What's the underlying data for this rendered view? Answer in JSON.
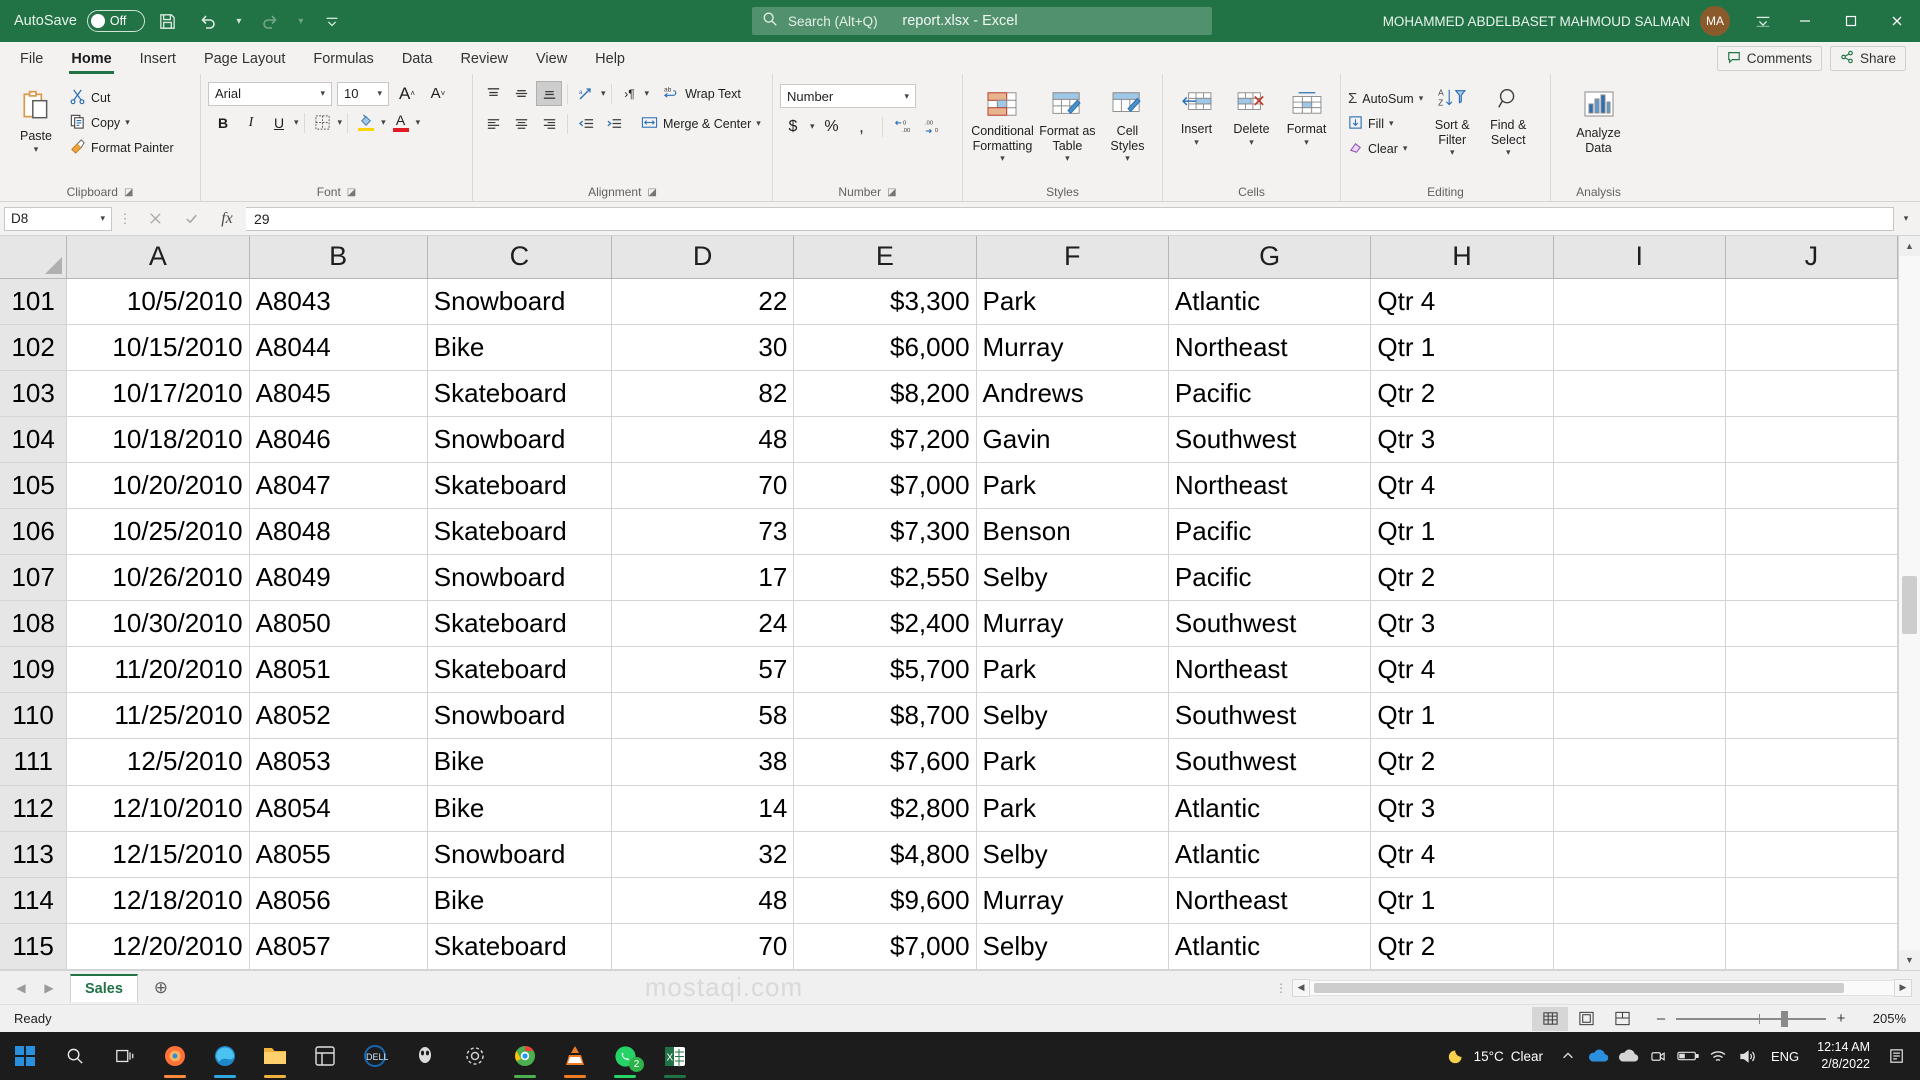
{
  "titlebar": {
    "autosave_label": "AutoSave",
    "autosave_state": "Off",
    "save_icon": "save-icon",
    "undo_icon": "undo-icon",
    "redo_icon": "redo-icon",
    "customize_qat_icon": "customize-quick-access-toolbar-icon",
    "document_title": "report.xlsx  -  Excel",
    "search_placeholder": "Search (Alt+Q)",
    "search_icon": "search-icon",
    "user_name": "MOHAMMED ABDELBASET MAHMOUD SALMAN",
    "avatar_initials": "MA",
    "ribbon_display_icon": "ribbon-display-options-icon",
    "minimize_label": "–",
    "maximize_label": "☐",
    "close_label": "✕"
  },
  "ribbon_tabs": [
    {
      "label": "File",
      "active": false
    },
    {
      "label": "Home",
      "active": true
    },
    {
      "label": "Insert",
      "active": false
    },
    {
      "label": "Page Layout",
      "active": false
    },
    {
      "label": "Formulas",
      "active": false
    },
    {
      "label": "Data",
      "active": false
    },
    {
      "label": "Review",
      "active": false
    },
    {
      "label": "View",
      "active": false
    },
    {
      "label": "Help",
      "active": false
    }
  ],
  "tabrow_right": {
    "comments_label": "Comments",
    "comments_icon": "comment-icon",
    "share_label": "Share",
    "share_icon": "share-icon"
  },
  "ribbon": {
    "clipboard": {
      "group_label": "Clipboard",
      "paste_label": "Paste",
      "cut_label": "Cut",
      "copy_label": "Copy",
      "format_painter_label": "Format Painter"
    },
    "font": {
      "group_label": "Font",
      "font_name": "Arial",
      "font_size": "10",
      "grow_font_label": "A",
      "shrink_font_label": "A",
      "bold_label": "B",
      "italic_label": "I",
      "underline_label": "U",
      "borders_icon": "borders-icon",
      "fill_color_icon": "fill-color-icon",
      "font_color_label": "A"
    },
    "alignment": {
      "group_label": "Alignment",
      "top_align_icon": "align-top-icon",
      "middle_align_icon": "align-middle-icon",
      "bottom_align_icon": "align-bottom-icon",
      "orientation_icon": "orientation-icon",
      "text_direction_icon": "text-direction-icon",
      "wrap_text_label": "Wrap Text",
      "align_left_icon": "align-left-icon",
      "align_center_icon": "align-center-icon",
      "align_right_icon": "align-right-icon",
      "decrease_indent_icon": "decrease-indent-icon",
      "increase_indent_icon": "increase-indent-icon",
      "merge_center_label": "Merge & Center"
    },
    "number": {
      "group_label": "Number",
      "format": "Number",
      "currency_label": "$",
      "percent_label": "%",
      "comma_label": ",",
      "increase_decimal_icon": "increase-decimal-icon",
      "decrease_decimal_icon": "decrease-decimal-icon"
    },
    "styles": {
      "group_label": "Styles",
      "conditional_formatting_label": "Conditional\nFormatting",
      "format_as_table_label": "Format as\nTable",
      "cell_styles_label": "Cell\nStyles"
    },
    "cells": {
      "group_label": "Cells",
      "insert_label": "Insert",
      "delete_label": "Delete",
      "format_label": "Format"
    },
    "editing": {
      "group_label": "Editing",
      "autosum_label": "AutoSum",
      "fill_label": "Fill",
      "clear_label": "Clear",
      "sort_filter_label": "Sort &\nFilter",
      "find_select_label": "Find &\nSelect"
    },
    "analysis": {
      "group_label": "Analysis",
      "analyze_data_label": "Analyze\nData"
    }
  },
  "formula_bar": {
    "name_box": "D8",
    "cancel_icon": "cancel-icon",
    "enter_icon": "confirm-icon",
    "function_icon": "insert-function-icon",
    "formula_value": "29"
  },
  "sheet": {
    "column_headers": [
      "A",
      "B",
      "C",
      "D",
      "E",
      "F",
      "G",
      "H",
      "I",
      "J"
    ],
    "rows": [
      {
        "row": "101",
        "cells": [
          "10/5/2010",
          "A8043",
          "Snowboard",
          "22",
          "$3,300",
          "Park",
          "Atlantic",
          "Qtr 4",
          "",
          ""
        ]
      },
      {
        "row": "102",
        "cells": [
          "10/15/2010",
          "A8044",
          "Bike",
          "30",
          "$6,000",
          "Murray",
          "Northeast",
          "Qtr 1",
          "",
          ""
        ]
      },
      {
        "row": "103",
        "cells": [
          "10/17/2010",
          "A8045",
          "Skateboard",
          "82",
          "$8,200",
          "Andrews",
          "Pacific",
          "Qtr 2",
          "",
          ""
        ]
      },
      {
        "row": "104",
        "cells": [
          "10/18/2010",
          "A8046",
          "Snowboard",
          "48",
          "$7,200",
          "Gavin",
          "Southwest",
          "Qtr 3",
          "",
          ""
        ]
      },
      {
        "row": "105",
        "cells": [
          "10/20/2010",
          "A8047",
          "Skateboard",
          "70",
          "$7,000",
          "Park",
          "Northeast",
          "Qtr 4",
          "",
          ""
        ]
      },
      {
        "row": "106",
        "cells": [
          "10/25/2010",
          "A8048",
          "Skateboard",
          "73",
          "$7,300",
          "Benson",
          "Pacific",
          "Qtr 1",
          "",
          ""
        ]
      },
      {
        "row": "107",
        "cells": [
          "10/26/2010",
          "A8049",
          "Snowboard",
          "17",
          "$2,550",
          "Selby",
          "Pacific",
          "Qtr 2",
          "",
          ""
        ]
      },
      {
        "row": "108",
        "cells": [
          "10/30/2010",
          "A8050",
          "Skateboard",
          "24",
          "$2,400",
          "Murray",
          "Southwest",
          "Qtr 3",
          "",
          ""
        ]
      },
      {
        "row": "109",
        "cells": [
          "11/20/2010",
          "A8051",
          "Skateboard",
          "57",
          "$5,700",
          "Park",
          "Northeast",
          "Qtr 4",
          "",
          ""
        ]
      },
      {
        "row": "110",
        "cells": [
          "11/25/2010",
          "A8052",
          "Snowboard",
          "58",
          "$8,700",
          "Selby",
          "Southwest",
          "Qtr 1",
          "",
          ""
        ]
      },
      {
        "row": "111",
        "cells": [
          "12/5/2010",
          "A8053",
          "Bike",
          "38",
          "$7,600",
          "Park",
          "Southwest",
          "Qtr 2",
          "",
          ""
        ]
      },
      {
        "row": "112",
        "cells": [
          "12/10/2010",
          "A8054",
          "Bike",
          "14",
          "$2,800",
          "Park",
          "Atlantic",
          "Qtr 3",
          "",
          ""
        ]
      },
      {
        "row": "113",
        "cells": [
          "12/15/2010",
          "A8055",
          "Snowboard",
          "32",
          "$4,800",
          "Selby",
          "Atlantic",
          "Qtr 4",
          "",
          ""
        ]
      },
      {
        "row": "114",
        "cells": [
          "12/18/2010",
          "A8056",
          "Bike",
          "48",
          "$9,600",
          "Murray",
          "Northeast",
          "Qtr 1",
          "",
          ""
        ]
      },
      {
        "row": "115",
        "cells": [
          "12/20/2010",
          "A8057",
          "Skateboard",
          "70",
          "$7,000",
          "Selby",
          "Atlantic",
          "Qtr 2",
          "",
          ""
        ]
      }
    ]
  },
  "sheet_tabs": {
    "prev_icon": "previous-sheet-icon",
    "next_icon": "next-sheet-icon",
    "tabs": [
      {
        "label": "Sales",
        "active": true
      }
    ],
    "add_sheet_label": "⊕",
    "watermark": "mostaqi.com"
  },
  "status_bar": {
    "status_text": "Ready",
    "normal_view_icon": "normal-view-icon",
    "page_layout_icon": "page-layout-view-icon",
    "page_break_icon": "page-break-preview-icon",
    "zoom_out_label": "–",
    "zoom_in_label": "+",
    "zoom_level": "205%"
  },
  "taskbar": {
    "start_icon": "windows-start-icon",
    "search_icon": "taskbar-search-icon",
    "task_view_icon": "task-view-icon",
    "apps": [
      {
        "name": "firefox-icon",
        "color": "#ff8a3d",
        "underline": "#ff8a3d",
        "badge": ""
      },
      {
        "name": "edge-icon",
        "color": "#2fa7df",
        "underline": "#2fa7df",
        "badge": ""
      },
      {
        "name": "file-explorer-icon",
        "color": "#f2b33d",
        "underline": "#f2b33d",
        "badge": ""
      },
      {
        "name": "microsoft-store-icon",
        "color": "#e8e8e8",
        "underline": "",
        "badge": ""
      },
      {
        "name": "dell-icon",
        "color": "#1767b0",
        "underline": "",
        "badge": ""
      },
      {
        "name": "alienware-icon",
        "color": "#dddddd",
        "underline": "",
        "badge": ""
      },
      {
        "name": "settings-icon",
        "color": "#cfcfcf",
        "underline": "",
        "badge": ""
      },
      {
        "name": "chrome-icon",
        "color": "#4caf50",
        "underline": "#4caf50",
        "badge": ""
      },
      {
        "name": "vlc-icon",
        "color": "#ef7c22",
        "underline": "#ef7c22",
        "badge": ""
      },
      {
        "name": "whatsapp-icon",
        "color": "#25d366",
        "underline": "#25d366",
        "badge": "2"
      },
      {
        "name": "excel-icon",
        "color": "#217346",
        "underline": "#217346",
        "badge": ""
      }
    ],
    "tray": {
      "weather_icon": "moon-icon",
      "temperature": "15°C",
      "condition": "Clear",
      "show_hidden_icon": "show-hidden-icons-icon",
      "onedrive_icon": "onedrive-icon",
      "cloud_icon": "cloud-icon",
      "meet_icon": "camera-icon",
      "battery_icon": "battery-icon",
      "network_icon": "wifi-icon",
      "volume_icon": "volume-icon",
      "language": "ENG",
      "time": "12:14 AM",
      "date": "2/8/2022",
      "notification_icon": "notifications-icon"
    }
  }
}
